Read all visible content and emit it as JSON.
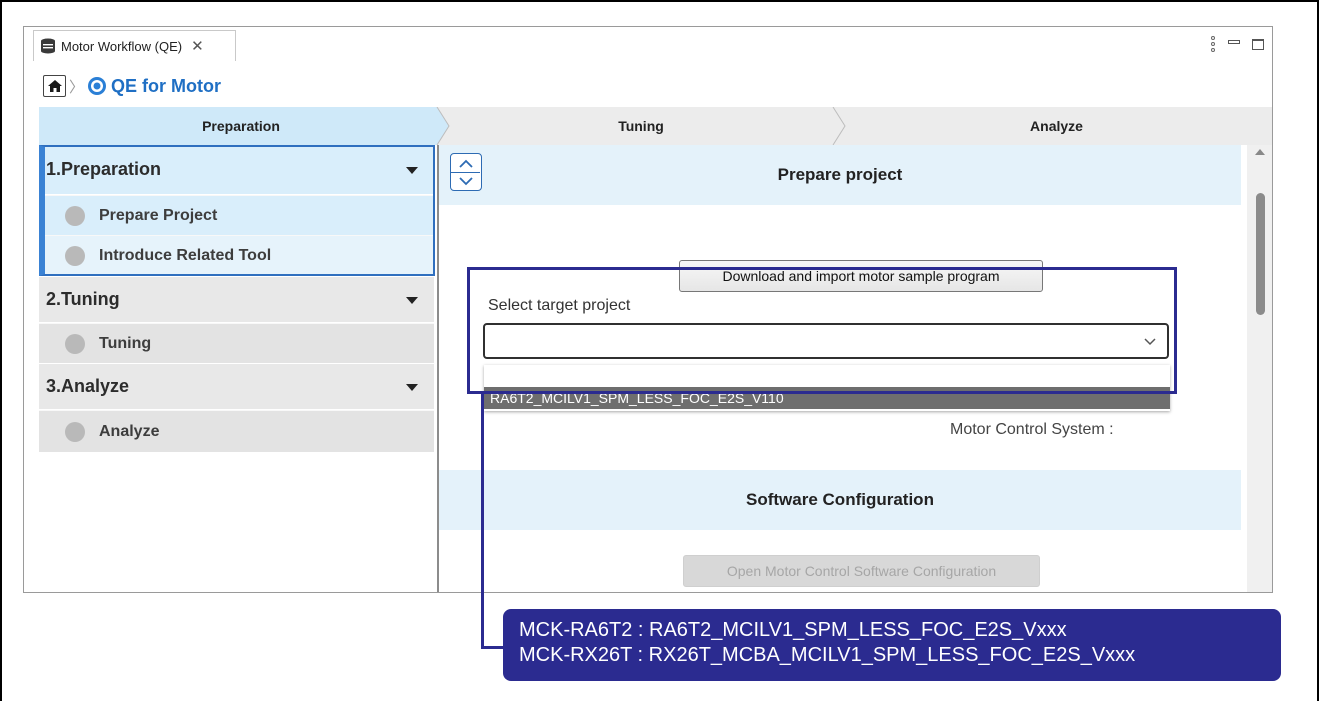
{
  "window": {
    "tab_title": "Motor Workflow (QE)",
    "tab_close": "✕"
  },
  "breadcrumb": {
    "title": "QE for Motor",
    "separator": "〉"
  },
  "steps": [
    {
      "label": "Preparation",
      "active": true
    },
    {
      "label": "Tuning",
      "active": false
    },
    {
      "label": "Analyze",
      "active": false
    }
  ],
  "sidebar": {
    "groups": [
      {
        "title": "1.Preparation",
        "expanded": true,
        "items": [
          "Prepare Project",
          "Introduce Related Tool"
        ]
      },
      {
        "title": "2.Tuning",
        "expanded": true,
        "items": [
          "Tuning"
        ]
      },
      {
        "title": "3.Analyze",
        "expanded": true,
        "items": [
          "Analyze"
        ]
      }
    ]
  },
  "main": {
    "prepare_section_title": "Prepare project",
    "download_button": "Download and import motor sample program",
    "select_label": "Select target project",
    "select_value": "",
    "dropdown_options": [
      "",
      "RA6T2_MCILV1_SPM_LESS_FOC_E2S_V110"
    ],
    "motor_control_system_label": "Motor Control System :",
    "software_section_title": "Software Configuration",
    "open_config_button": "Open Motor Control Software Configuration"
  },
  "callout": {
    "line1": "MCK-RA6T2 : RA6T2_MCILV1_SPM_LESS_FOC_E2S_Vxxx",
    "line2": "MCK-RX26T : RX26T_MCBA_MCILV1_SPM_LESS_FOC_E2S_Vxxx"
  },
  "colors": {
    "accent_blue": "#1f6fc4",
    "active_step": "#cfe9f9",
    "section_band": "#e4f2fa",
    "callout_bg": "#2b2b90"
  },
  "icons": {
    "tab": "database-icon",
    "home": "home-icon",
    "logo": "qe-motor-logo-icon"
  }
}
